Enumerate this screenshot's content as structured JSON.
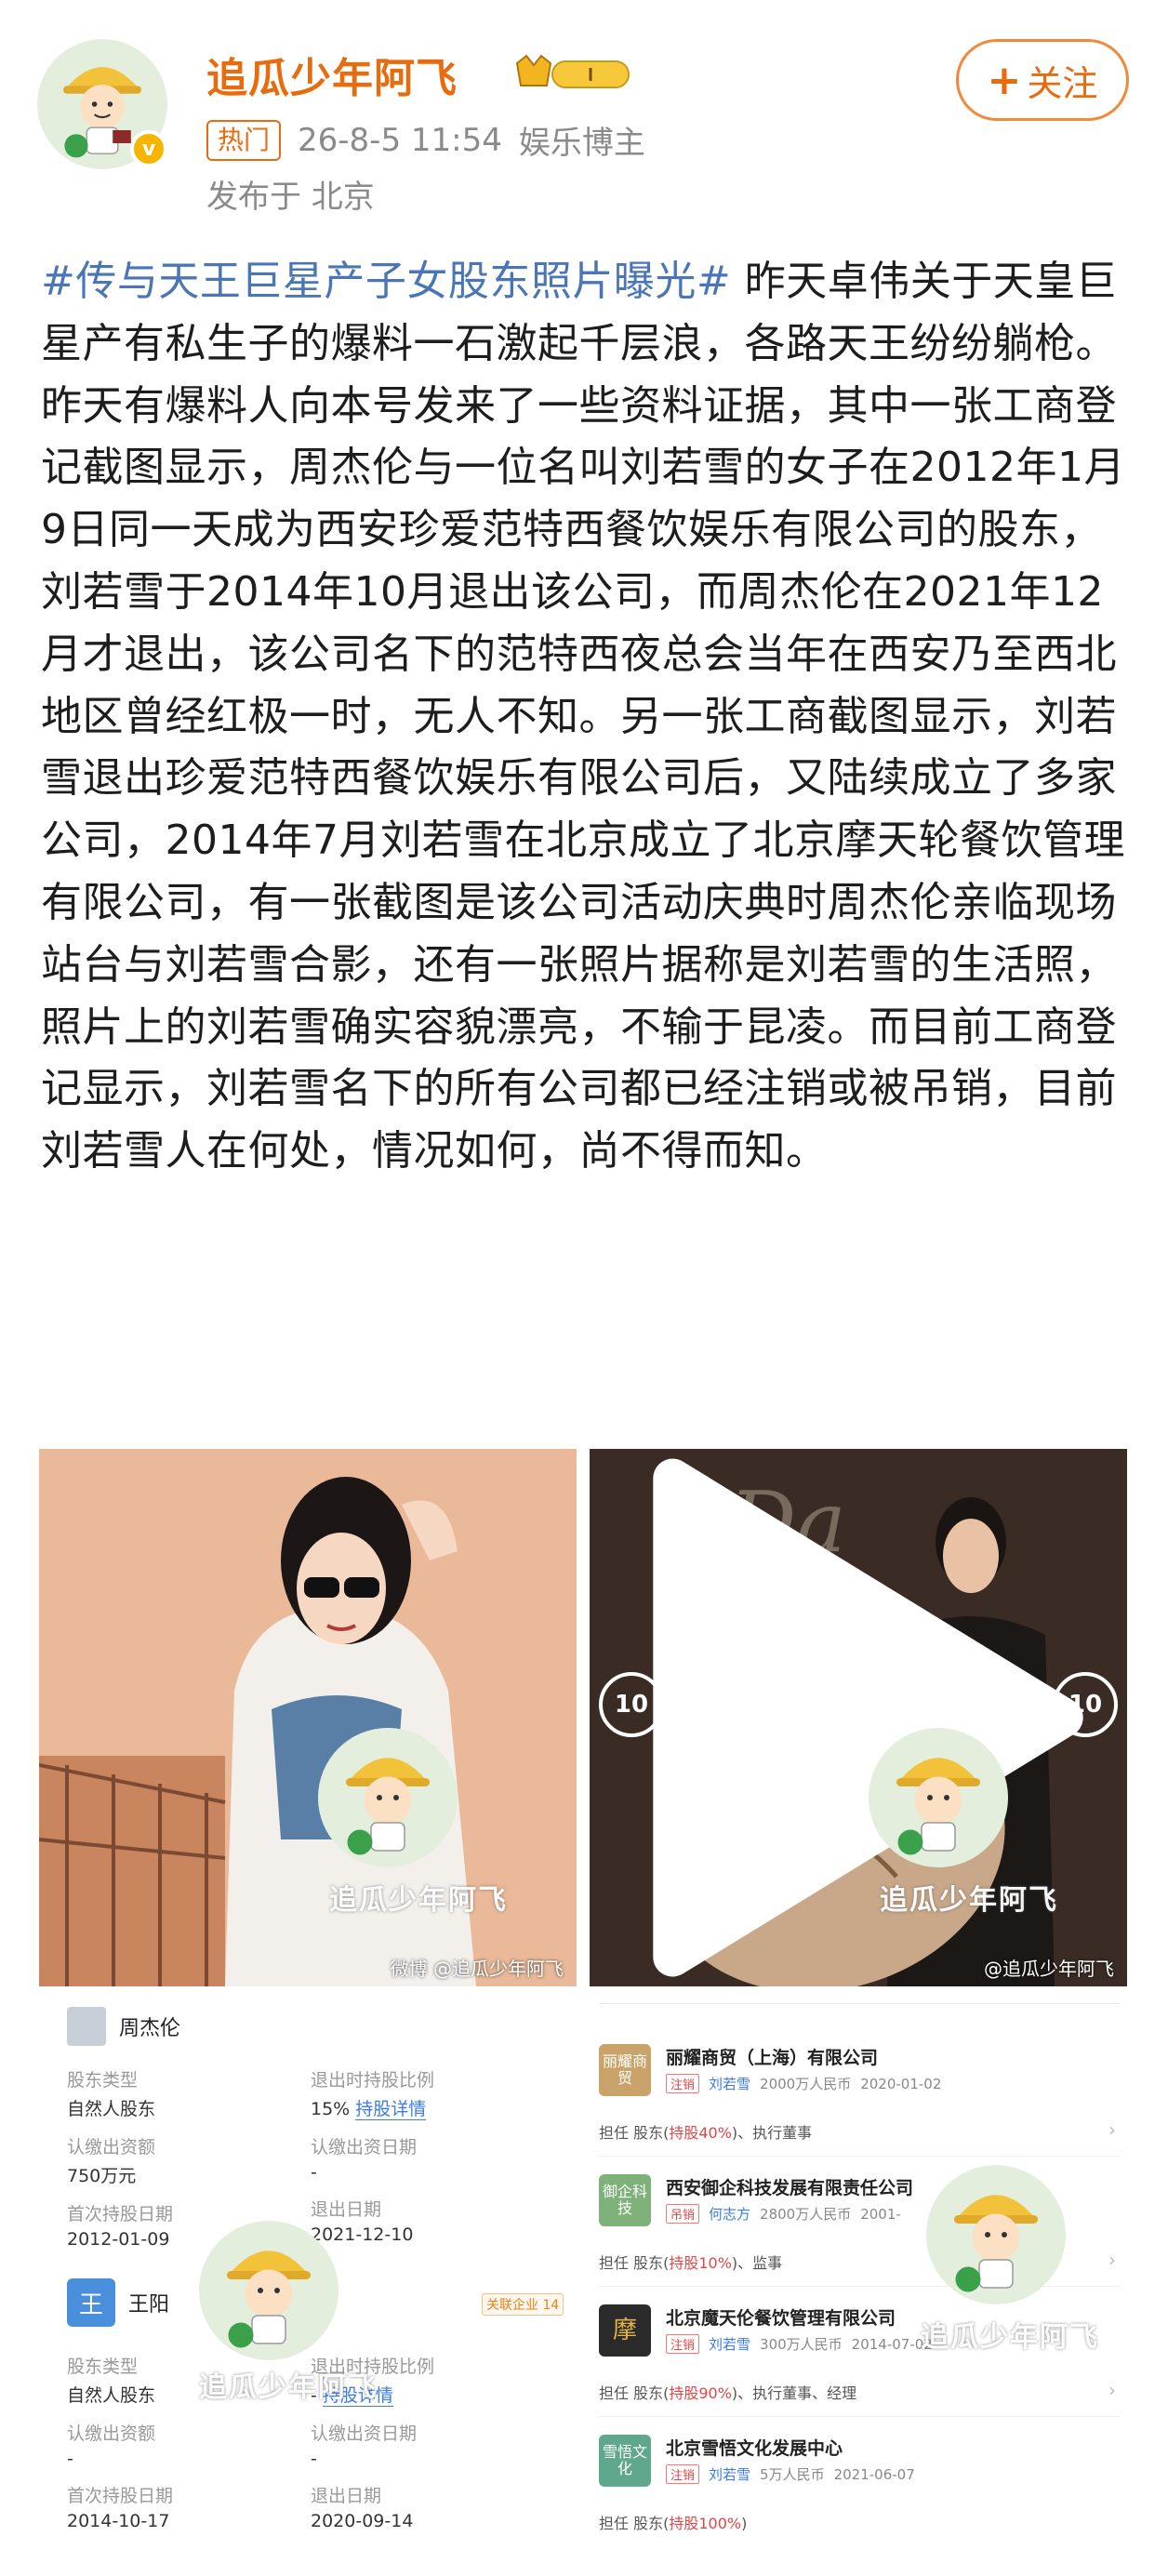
{
  "header": {
    "username": "追瓜少年阿飞",
    "member_level": "I",
    "hot_tag": "热门",
    "timestamp": "26-8-5 11:54",
    "category": "娱乐博主",
    "location": "发布于 北京",
    "follow_label": "关注",
    "follow_plus": "+"
  },
  "post": {
    "topic": "#传与天王巨星产子女股东照片曝光#",
    "body": " 昨天卓伟关于天皇巨星产有私生子的爆料一石激起千层浪，各路天王纷纷躺枪。昨天有爆料人向本号发来了一些资料证据，其中一张工商登记截图显示，周杰伦与一位名叫刘若雪的女子在2012年1月9日同一天成为西安珍爱范特西餐饮娱乐有限公司的股东，刘若雪于2014年10月退出该公司，而周杰伦在2021年12月才退出，该公司名下的范特西夜总会当年在西安乃至西北地区曾经红极一时，无人不知。另一张工商截图显示，刘若雪退出珍爱范特西餐饮娱乐有限公司后，又陆续成立了多家公司，2014年7月刘若雪在北京成立了北京摩天轮餐饮管理有限公司，有一张截图是该公司活动庆典时周杰伦亲临现场站台与刘若雪合影，还有一张照片据称是刘若雪的生活照，照片上的刘若雪确实容貌漂亮，不输于昆凌。而目前工商登记显示，刘若雪名下的所有公司都已经注销或被吊销，目前刘若雪人在何处，情况如何，尚不得而知。"
  },
  "images": {
    "watermark_text": "追瓜少年阿飞",
    "corner_watermark_1": "微博 @追瓜少年阿飞",
    "corner_watermark_2": "@追瓜少年阿飞",
    "video_skip_back": "10",
    "video_skip_forward": "10"
  },
  "shareholders": [
    {
      "name": "周杰伦",
      "type_label": "股东类型",
      "type_value": "自然人股东",
      "ratio_label": "退出时持股比例",
      "ratio_value": "15%",
      "ratio_link": "持股详情",
      "sub_label": "认缴出资额",
      "sub_value": "750万元",
      "sub_date_label": "认缴出资日期",
      "sub_date_value": "-",
      "first_label": "首次持股日期",
      "first_value": "2012-01-09",
      "exit_label": "退出日期",
      "exit_value": "2021-12-10"
    },
    {
      "name": "王阳",
      "avatar_char": "王",
      "related_tag": "关联企业 14",
      "type_label": "股东类型",
      "type_value": "自然人股东",
      "ratio_label": "退出时持股比例",
      "ratio_value": "-",
      "ratio_link": "持股详情",
      "sub_label": "认缴出资额",
      "sub_value": "-",
      "sub_date_label": "认缴出资日期",
      "sub_date_value": "-",
      "first_label": "首次持股日期",
      "first_value": "2014-10-17",
      "exit_label": "退出日期",
      "exit_value": "2020-09-14"
    }
  ],
  "companies": [
    {
      "logo": "丽耀商贸",
      "logo_color": "#c9a36a",
      "name": "丽耀商贸（上海）有限公司",
      "status": "注销",
      "person": "刘若雪",
      "capital": "2000万人民币",
      "date": "2020-01-02",
      "role_prefix": "担任 股东(",
      "pct": "持股40%",
      "role_suffix": ")、执行董事"
    },
    {
      "logo": "御企科技",
      "logo_color": "#7fb27a",
      "name": "西安御企科技发展有限责任公司",
      "status": "吊销",
      "person": "何志方",
      "capital": "2800万人民币",
      "date": "2001-",
      "role_prefix": "担任 股东(",
      "pct": "持股10%",
      "role_suffix": ")、监事"
    },
    {
      "logo": "摩",
      "logo_color": "#2b2b2b",
      "name": "北京魔天伦餐饮管理有限公司",
      "status": "注销",
      "person": "刘若雪",
      "capital": "300万人民币",
      "date": "2014-07-02",
      "role_prefix": "担任 股东(",
      "pct": "持股90%",
      "role_suffix": ")、执行董事、经理"
    },
    {
      "logo": "雪悟文化",
      "logo_color": "#5fa78d",
      "name": "北京雪悟文化发展中心",
      "status": "注销",
      "person": "刘若雪",
      "capital": "5万人民币",
      "date": "2021-06-07",
      "role_prefix": "担任 股东(",
      "pct": "持股100%",
      "role_suffix": ")"
    }
  ],
  "colors": {
    "brand_orange": "#e86b0e",
    "topic_blue": "#4a76b5",
    "meta_gray": "#8a8a8a"
  }
}
